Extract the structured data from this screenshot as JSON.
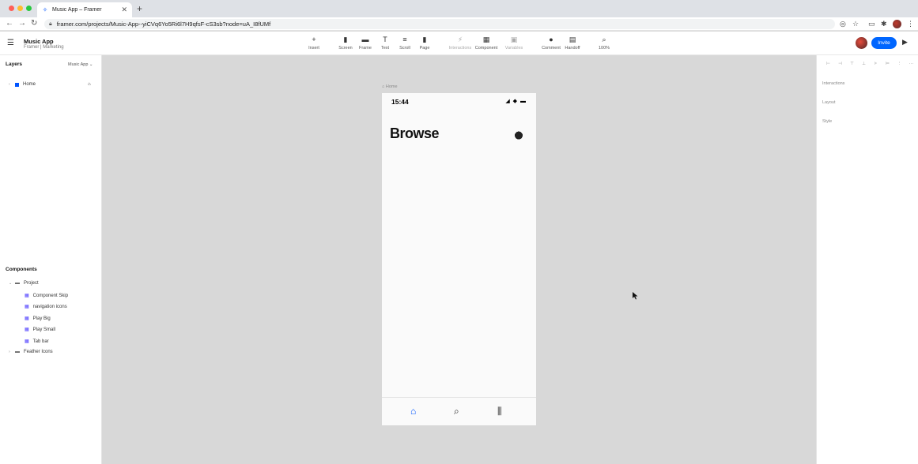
{
  "browser": {
    "tab_title": "Music App – Framer",
    "tab_close": "✕",
    "new_tab": "+",
    "url": "framer.com/projects/Music-App--yiCVq6Yo5Ri6l7H9qfsF-cS3sb?node=uA_I8fUMf"
  },
  "toolbar": {
    "project_name": "Music App",
    "project_sub": "Framer | Marketing",
    "tools": [
      {
        "label": "Insert",
        "icon": "+"
      },
      {
        "label": "Screen",
        "icon": "▮"
      },
      {
        "label": "Frame",
        "icon": "▬"
      },
      {
        "label": "Text",
        "icon": "T"
      },
      {
        "label": "Scroll",
        "icon": "≡"
      },
      {
        "label": "Page",
        "icon": "▮"
      },
      {
        "label": "Interactions",
        "icon": "⚡"
      },
      {
        "label": "Component",
        "icon": "▦"
      },
      {
        "label": "Variables",
        "icon": "▣"
      },
      {
        "label": "Comment",
        "icon": "●"
      },
      {
        "label": "Handoff",
        "icon": "▤"
      },
      {
        "label": "100%",
        "icon": "⌕"
      }
    ],
    "invite_label": "Invite"
  },
  "layers": {
    "title": "Layers",
    "page_selector": "Music App",
    "items": [
      {
        "label": "Home"
      }
    ]
  },
  "components": {
    "title": "Components",
    "project_folder": "Project",
    "items": [
      {
        "label": "Component Skip"
      },
      {
        "label": "navigation icons"
      },
      {
        "label": "Play Big"
      },
      {
        "label": "Play Small"
      },
      {
        "label": "Tab bar"
      }
    ],
    "feather_folder": "Feather Icons"
  },
  "canvas": {
    "frame_label": "Home",
    "status_time": "15:44",
    "heading": "Browse"
  },
  "right_panel": {
    "sections": [
      "Interactions",
      "Layout",
      "Style"
    ]
  },
  "colors": {
    "accent": "#0066ff",
    "canvas_bg": "#d8d8d8",
    "component_icon": "#4a3aff"
  }
}
